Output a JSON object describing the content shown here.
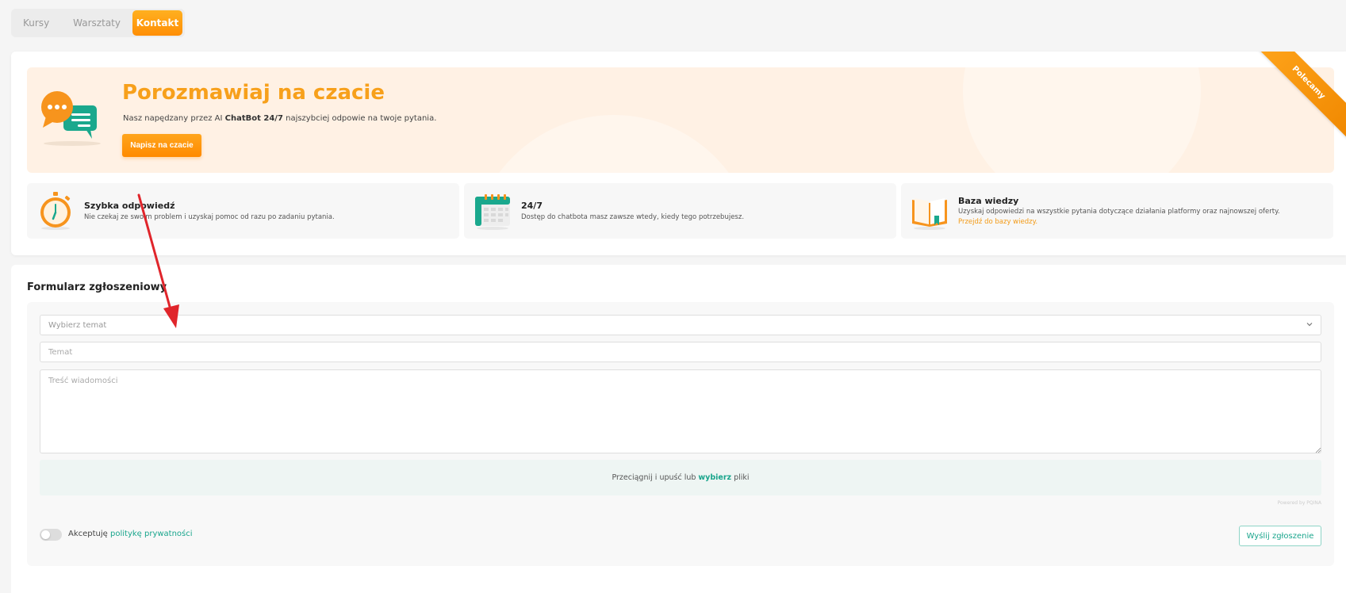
{
  "tabs": [
    {
      "label": "Kursy"
    },
    {
      "label": "Warsztaty"
    },
    {
      "label": "Kontakt",
      "active": true
    }
  ],
  "ribbon": {
    "label": "Polecamy"
  },
  "hero": {
    "title": "Porozmawiaj na czacie",
    "desc_prefix": "Nasz napędzany przez AI ",
    "desc_bold": "ChatBot 24/7",
    "desc_suffix": " najszybciej odpowie na twoje pytania.",
    "button_label": "Napisz na czacie",
    "icon": "chat-bubbles-icon"
  },
  "features": [
    {
      "title": "Szybka odpowiedź",
      "desc": "Nie czekaj ze swoim problem i uzyskaj pomoc od razu po zadaniu pytania.",
      "icon": "stopwatch-icon"
    },
    {
      "title": "24/7",
      "desc": "Dostęp do chatbota masz zawsze wtedy, kiedy tego potrzebujesz.",
      "icon": "calendar-icon"
    },
    {
      "title": "Baza wiedzy",
      "desc": "Uzyskaj odpowiedzi na wszystkie pytania dotyczące działania platformy oraz najnowszej oferty.",
      "link": "Przejdź do bazy wiedzy.",
      "icon": "open-book-icon"
    }
  ],
  "form": {
    "title": "Formularz zgłoszeniowy",
    "topic_placeholder": "Wybierz temat",
    "subject_placeholder": "Temat",
    "message_placeholder": "Treść wiadomości",
    "dropzone_prefix": "Przeciągnij i upuść lub",
    "dropzone_link": "wybierz",
    "dropzone_suffix": "pliki",
    "powered_by": "Powered by PQINA",
    "accept_prefix": "Akceptuję ",
    "accept_link": "politykę prywatności",
    "submit_label": "Wyślij zgłoszenie"
  },
  "colors": {
    "accent_orange": "#f7a01b",
    "accent_teal": "#19a58c",
    "annotation_red": "#e0252b"
  }
}
